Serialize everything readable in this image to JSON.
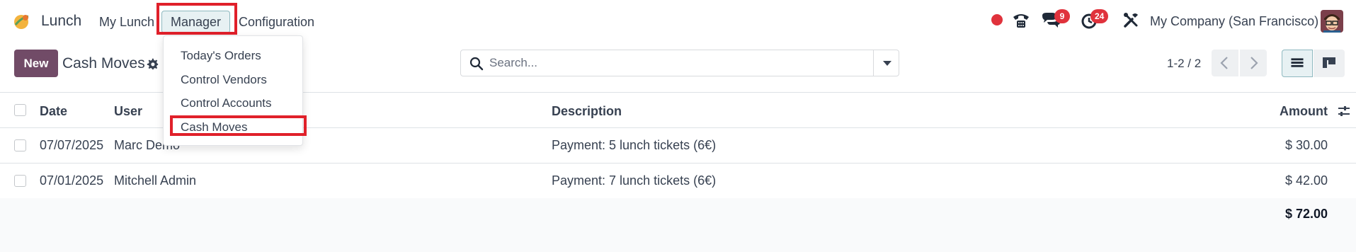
{
  "navbar": {
    "app_name": "Lunch",
    "menu": [
      "My Lunch",
      "Manager",
      "Configuration"
    ],
    "messages_badge": "9",
    "activities_badge": "24",
    "company": "My Company (San Francisco)"
  },
  "manager_menu": {
    "items": [
      "Today's Orders",
      "Control Vendors",
      "Control Accounts",
      "Cash Moves"
    ]
  },
  "control_panel": {
    "new_label": "New",
    "title": "Cash Moves",
    "search_placeholder": "Search...",
    "pager": "1-2 / 2"
  },
  "table": {
    "headers": {
      "date": "Date",
      "user": "User",
      "description": "Description",
      "amount": "Amount"
    },
    "rows": [
      {
        "date": "07/07/2025",
        "user": "Marc Demo",
        "description": "Payment: 5 lunch tickets (6€)",
        "amount": "$ 30.00"
      },
      {
        "date": "07/01/2025",
        "user": "Mitchell Admin",
        "description": "Payment: 7 lunch tickets (6€)",
        "amount": "$ 42.00"
      }
    ],
    "total": "$ 72.00"
  },
  "colors": {
    "primary": "#714b67",
    "badge": "#e0323c",
    "highlight": "#e0202a"
  },
  "icons": [
    "lunch-app-icon",
    "phone-icon",
    "chat-icon",
    "clock-icon",
    "tools-icon",
    "gear-icon",
    "search-icon",
    "caret-down-icon",
    "chevron-left-icon",
    "chevron-right-icon",
    "list-view-icon",
    "kanban-view-icon",
    "optional-columns-icon"
  ]
}
